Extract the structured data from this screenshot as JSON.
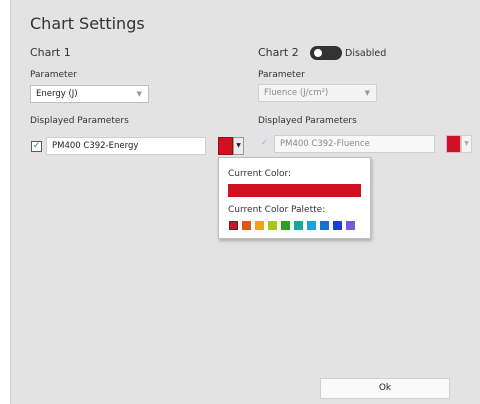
{
  "dialog": {
    "title": "Chart Settings"
  },
  "chart1": {
    "header": "Chart 1",
    "parameter_label": "Parameter",
    "parameter_value": "Energy (J)",
    "displayed_label": "Displayed Parameters",
    "item": {
      "checked": true,
      "text": "PM400 C392-Energy"
    }
  },
  "chart2": {
    "header": "Chart 2",
    "toggle_state": "Disabled",
    "parameter_label": "Parameter",
    "parameter_value": "Fluence (J/cm²)",
    "displayed_label": "Displayed Parameters",
    "item": {
      "checked": true,
      "text": "PM400 C392-Fluence"
    }
  },
  "color_popup": {
    "current_color_label": "Current Color:",
    "current_color": "#cf1123",
    "palette_label": "Current Color Palette:",
    "palette": [
      "#cf1123",
      "#e0571a",
      "#f0a21b",
      "#a8c716",
      "#2aa21d",
      "#17a89a",
      "#1aa3d4",
      "#1a6fd0",
      "#1a3ed0",
      "#7a5ad4"
    ],
    "selected_index": 0
  },
  "footer": {
    "ok_label": "Ok"
  },
  "icons": {
    "check": "checkmark-icon",
    "dropdown": "chevron-down-icon"
  }
}
